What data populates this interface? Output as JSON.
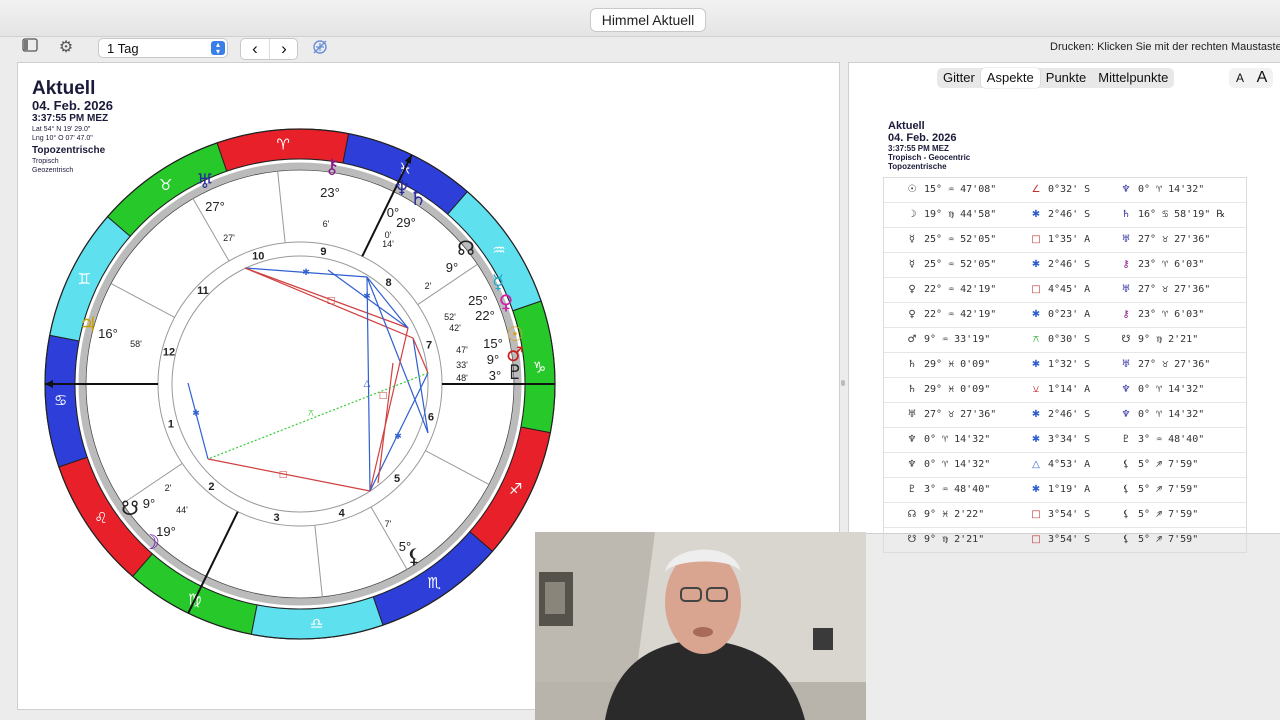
{
  "window": {
    "title": "Himmel Aktuell"
  },
  "toolbar": {
    "period_value": "1 Tag",
    "print_hint": "Drucken: Klicken Sie mit der rechten Maustaste"
  },
  "chart_header": {
    "title": "Aktuell",
    "date": "04. Feb. 2026",
    "time": "3:37:55 PM MEZ",
    "lat": "Lat 54° N 19' 29.0\"",
    "lng": "Lng 10° O 07' 47.0\"",
    "house_system": "Topozentrische",
    "zodiac": "Tropisch",
    "center": "Geozentrisch"
  },
  "wheel": {
    "houses": [
      "1",
      "2",
      "3",
      "4",
      "5",
      "6",
      "7",
      "8",
      "9",
      "10",
      "11",
      "12"
    ],
    "sign_colors": {
      "fire": "#e8202a",
      "earth": "#27c92a",
      "air": "#5ee0ee",
      "water": "#2d3fd8"
    },
    "aspect_colors": {
      "blue": "#2f5fd0",
      "red": "#d04040",
      "green": "#33cc33"
    },
    "planet_labels": [
      {
        "id": "chiron",
        "deg": "23°",
        "min": "6'",
        "color": "#8a1a8a"
      },
      {
        "id": "uranus",
        "deg": "27°",
        "min": "27'",
        "color": "#2a2a9a"
      },
      {
        "id": "neptune",
        "deg": "0°",
        "min": "14'",
        "color": "#2a2a9a"
      },
      {
        "id": "saturn",
        "deg": "29°",
        "min": "0'",
        "color": "#2a2a9a"
      },
      {
        "id": "north-node",
        "deg": "9°",
        "min": "2'",
        "color": "#222"
      },
      {
        "id": "mercury",
        "deg": "25°",
        "min": "52'",
        "color": "#22aacc"
      },
      {
        "id": "venus",
        "deg": "22°",
        "min": "42'",
        "color": "#cc22aa"
      },
      {
        "id": "sun",
        "deg": "15°",
        "min": "47'",
        "color": "#e0a020"
      },
      {
        "id": "mars",
        "deg": "9°",
        "min": "33'",
        "color": "#cc2020"
      },
      {
        "id": "pluto",
        "deg": "3°",
        "min": "48'",
        "color": "#222"
      },
      {
        "id": "jupiter",
        "deg": "16°",
        "min": "58'",
        "color": "#c8a000"
      },
      {
        "id": "south-node",
        "deg": "9°",
        "min": "2'",
        "color": "#222"
      },
      {
        "id": "moon",
        "deg": "19°",
        "min": "44'",
        "color": "#6a1aaa"
      },
      {
        "id": "lilith",
        "deg": "5°",
        "min": "7'",
        "color": "#222"
      }
    ]
  },
  "tabs": [
    "Gitter",
    "Aspekte",
    "Punkte",
    "Mittelpunkte"
  ],
  "active_tab": "Aspekte",
  "font_buttons": [
    "A",
    "A"
  ],
  "aspects_header": {
    "title": "Aktuell",
    "date": "04. Feb. 2026",
    "time": "3:37:55 PM MEZ",
    "line1": "Tropisch - Geocentric",
    "line2": "Topozentrische"
  },
  "aspects": [
    {
      "p1": "☉",
      "p1c": "#333",
      "pos1": "15° ♒ 47'08\"",
      "asp": "∠",
      "ac": "#c03030",
      "orb": "0°32' S",
      "p2": "♆",
      "p2c": "#2a2a9a",
      "pos2": "0° ♈ 14'32\""
    },
    {
      "p1": "☽",
      "p1c": "#333",
      "pos1": "19° ♍ 44'58\"",
      "asp": "✱",
      "ac": "#2f5fd0",
      "orb": "2°46' S",
      "p2": "♄",
      "p2c": "#2a2a9a",
      "pos2": "16° ♋ 58'19\" ℞"
    },
    {
      "p1": "☿",
      "p1c": "#333",
      "pos1": "25° ♒ 52'05\"",
      "asp": "□",
      "ac": "#c03030",
      "orb": "1°35' A",
      "p2": "♅",
      "p2c": "#2a2a9a",
      "pos2": "27° ♉ 27'36\""
    },
    {
      "p1": "☿",
      "p1c": "#333",
      "pos1": "25° ♒ 52'05\"",
      "asp": "✱",
      "ac": "#2f5fd0",
      "orb": "2°46' S",
      "p2": "⚷",
      "p2c": "#8a1a8a",
      "pos2": "23° ♈ 6'03\""
    },
    {
      "p1": "♀",
      "p1c": "#333",
      "pos1": "22° ♒ 42'19\"",
      "asp": "□",
      "ac": "#c03030",
      "orb": "4°45' A",
      "p2": "♅",
      "p2c": "#2a2a9a",
      "pos2": "27° ♉ 27'36\""
    },
    {
      "p1": "♀",
      "p1c": "#333",
      "pos1": "22° ♒ 42'19\"",
      "asp": "✱",
      "ac": "#2f5fd0",
      "orb": "0°23' A",
      "p2": "⚷",
      "p2c": "#8a1a8a",
      "pos2": "23° ♈ 6'03\""
    },
    {
      "p1": "♂",
      "p1c": "#333",
      "pos1": "9° ♒ 33'19\"",
      "asp": "⚻",
      "ac": "#33aa33",
      "orb": "0°30' S",
      "p2": "☋",
      "p2c": "#222",
      "pos2": "9° ♍ 2'21\""
    },
    {
      "p1": "♄",
      "p1c": "#333",
      "pos1": "29° ♓ 0'09\"",
      "asp": "✱",
      "ac": "#2f5fd0",
      "orb": "1°32' S",
      "p2": "♅",
      "p2c": "#2a2a9a",
      "pos2": "27° ♉ 27'36\""
    },
    {
      "p1": "♄",
      "p1c": "#333",
      "pos1": "29° ♓ 0'09\"",
      "asp": "⚺",
      "ac": "#c03030",
      "orb": "1°14' A",
      "p2": "♆",
      "p2c": "#2a2a9a",
      "pos2": "0° ♈ 14'32\""
    },
    {
      "p1": "♅",
      "p1c": "#333",
      "pos1": "27° ♉ 27'36\"",
      "asp": "✱",
      "ac": "#2f5fd0",
      "orb": "2°46' S",
      "p2": "♆",
      "p2c": "#2a2a9a",
      "pos2": "0° ♈ 14'32\""
    },
    {
      "p1": "♆",
      "p1c": "#333",
      "pos1": "0° ♈ 14'32\"",
      "asp": "✱",
      "ac": "#2f5fd0",
      "orb": "3°34' S",
      "p2": "♇",
      "p2c": "#333",
      "pos2": "3° ♒ 48'40\""
    },
    {
      "p1": "♆",
      "p1c": "#333",
      "pos1": "0° ♈ 14'32\"",
      "asp": "△",
      "ac": "#2f5fd0",
      "orb": "4°53' A",
      "p2": "⚸",
      "p2c": "#333",
      "pos2": "5° ♐ 7'59\""
    },
    {
      "p1": "♇",
      "p1c": "#333",
      "pos1": "3° ♒ 48'40\"",
      "asp": "✱",
      "ac": "#2f5fd0",
      "orb": "1°19' A",
      "p2": "⚸",
      "p2c": "#333",
      "pos2": "5° ♐ 7'59\""
    },
    {
      "p1": "☊",
      "p1c": "#333",
      "pos1": "9° ♓ 2'22\"",
      "asp": "□",
      "ac": "#c03030",
      "orb": "3°54' S",
      "p2": "⚸",
      "p2c": "#333",
      "pos2": "5° ♐ 7'59\""
    },
    {
      "p1": "☋",
      "p1c": "#333",
      "pos1": "9° ♍ 2'21\"",
      "asp": "□",
      "ac": "#c03030",
      "orb": "3°54' S",
      "p2": "⚸",
      "p2c": "#333",
      "pos2": "5° ♐ 7'59\""
    }
  ]
}
